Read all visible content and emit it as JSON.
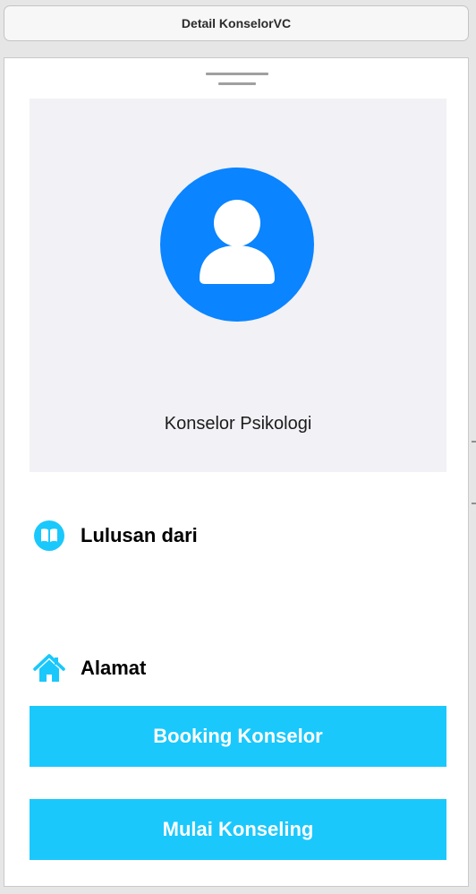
{
  "window": {
    "title": "Detail KonselorVC"
  },
  "profile": {
    "avatar_icon": "person-circle-icon",
    "name": "Konselor Psikologi",
    "background_color": "#f1f1f6",
    "avatar_color": "#0a84ff"
  },
  "info": {
    "education": {
      "icon": "book-circle-icon",
      "label": "Lulusan dari"
    },
    "address": {
      "icon": "house-icon",
      "label": "Alamat"
    }
  },
  "actions": {
    "booking_label": "Booking Konselor",
    "start_label": "Mulai Konseling",
    "button_color": "#1ac8fc"
  }
}
